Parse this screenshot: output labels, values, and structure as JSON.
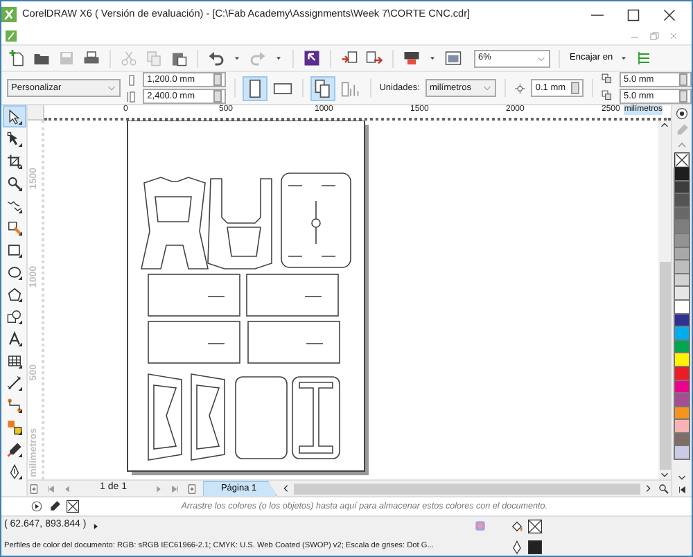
{
  "window": {
    "title": "CorelDRAW X6 ( Versión de evaluación) - [C:\\Fab Academy\\Assignments\\Week 7\\CORTE CNC.cdr]"
  },
  "standard_toolbar": {
    "buttons": [
      {
        "disabled": false
      },
      {
        "disabled": false
      },
      {
        "disabled": true
      },
      {
        "disabled": false
      },
      {
        "disabled": true
      },
      {
        "disabled": true
      },
      {
        "disabled": false
      },
      {
        "disabled": false
      },
      {
        "disabled": true
      },
      {
        "disabled": false
      },
      {
        "disabled": false
      },
      {
        "disabled": false
      },
      {
        "disabled": false
      },
      {
        "disabled": false
      }
    ],
    "zoom": "6%",
    "snap": "Encajar en"
  },
  "property_bar": {
    "page_size": "Personalizar",
    "width": "1,200.0 mm",
    "height": "2,400.0 mm",
    "orientation_portrait": true,
    "units_label": "Unidades:",
    "units": "milímetros",
    "nudge": "0.1 mm",
    "duplicate_x": "5.0 mm",
    "duplicate_y": "5.0 mm"
  },
  "horizontal_ruler": {
    "ticks": [
      "0",
      "500",
      "1000",
      "1500",
      "2000",
      "2500"
    ],
    "unit": "milímetros"
  },
  "vertical_ruler": {
    "ticks": [
      "1500",
      "1000",
      "500"
    ],
    "unit": "milímetros"
  },
  "toolbox": [
    {
      "selected": true
    },
    {
      "selected": false
    },
    {
      "selected": false
    },
    {
      "selected": false
    },
    {
      "selected": false
    },
    {
      "selected": false
    },
    {
      "selected": false
    },
    {
      "selected": false
    },
    {
      "selected": false
    },
    {
      "selected": false
    },
    {
      "selected": false
    },
    {
      "selected": false
    },
    {
      "selected": false
    },
    {
      "selected": false
    },
    {
      "selected": false
    },
    {
      "selected": false
    },
    {
      "selected": false
    }
  ],
  "palette": [
    {
      "color": "#1e1e1e"
    },
    {
      "color": "#3d3d3d"
    },
    {
      "color": "#545454"
    },
    {
      "color": "#696969"
    },
    {
      "color": "#7e7e7e"
    },
    {
      "color": "#939393"
    },
    {
      "color": "#a8a8a8"
    },
    {
      "color": "#bdbdbd"
    },
    {
      "color": "#d2d2d2"
    },
    {
      "color": "#e6e6e6"
    },
    {
      "color": "#ffffff"
    },
    {
      "color": "#2e3192"
    },
    {
      "color": "#00aeef"
    },
    {
      "color": "#00a651"
    },
    {
      "color": "#fff200"
    },
    {
      "color": "#ed1c24"
    },
    {
      "color": "#ec008c"
    },
    {
      "color": "#a54e94"
    },
    {
      "color": "#f7941d"
    },
    {
      "color": "#f8b3b5"
    },
    {
      "color": "#806d66"
    },
    {
      "color": "#cacbe5"
    }
  ],
  "page_navigator": {
    "count": "1 de 1",
    "tabs": [
      {
        "label": "Página 1",
        "selected": true
      }
    ]
  },
  "color_docker": {
    "hint": "Arrastre los colores (o los objetos) hasta aquí para almacenar estos colores con el documento."
  },
  "status_bar": {
    "coordinates": "( 62.647, 893.844 )",
    "color_profiles": "Perfiles de color del documento: RGB: sRGB IEC61966-2.1; CMYK: U.S. Web Coated (SWOP) v2; Escala de grises: Dot G..."
  }
}
